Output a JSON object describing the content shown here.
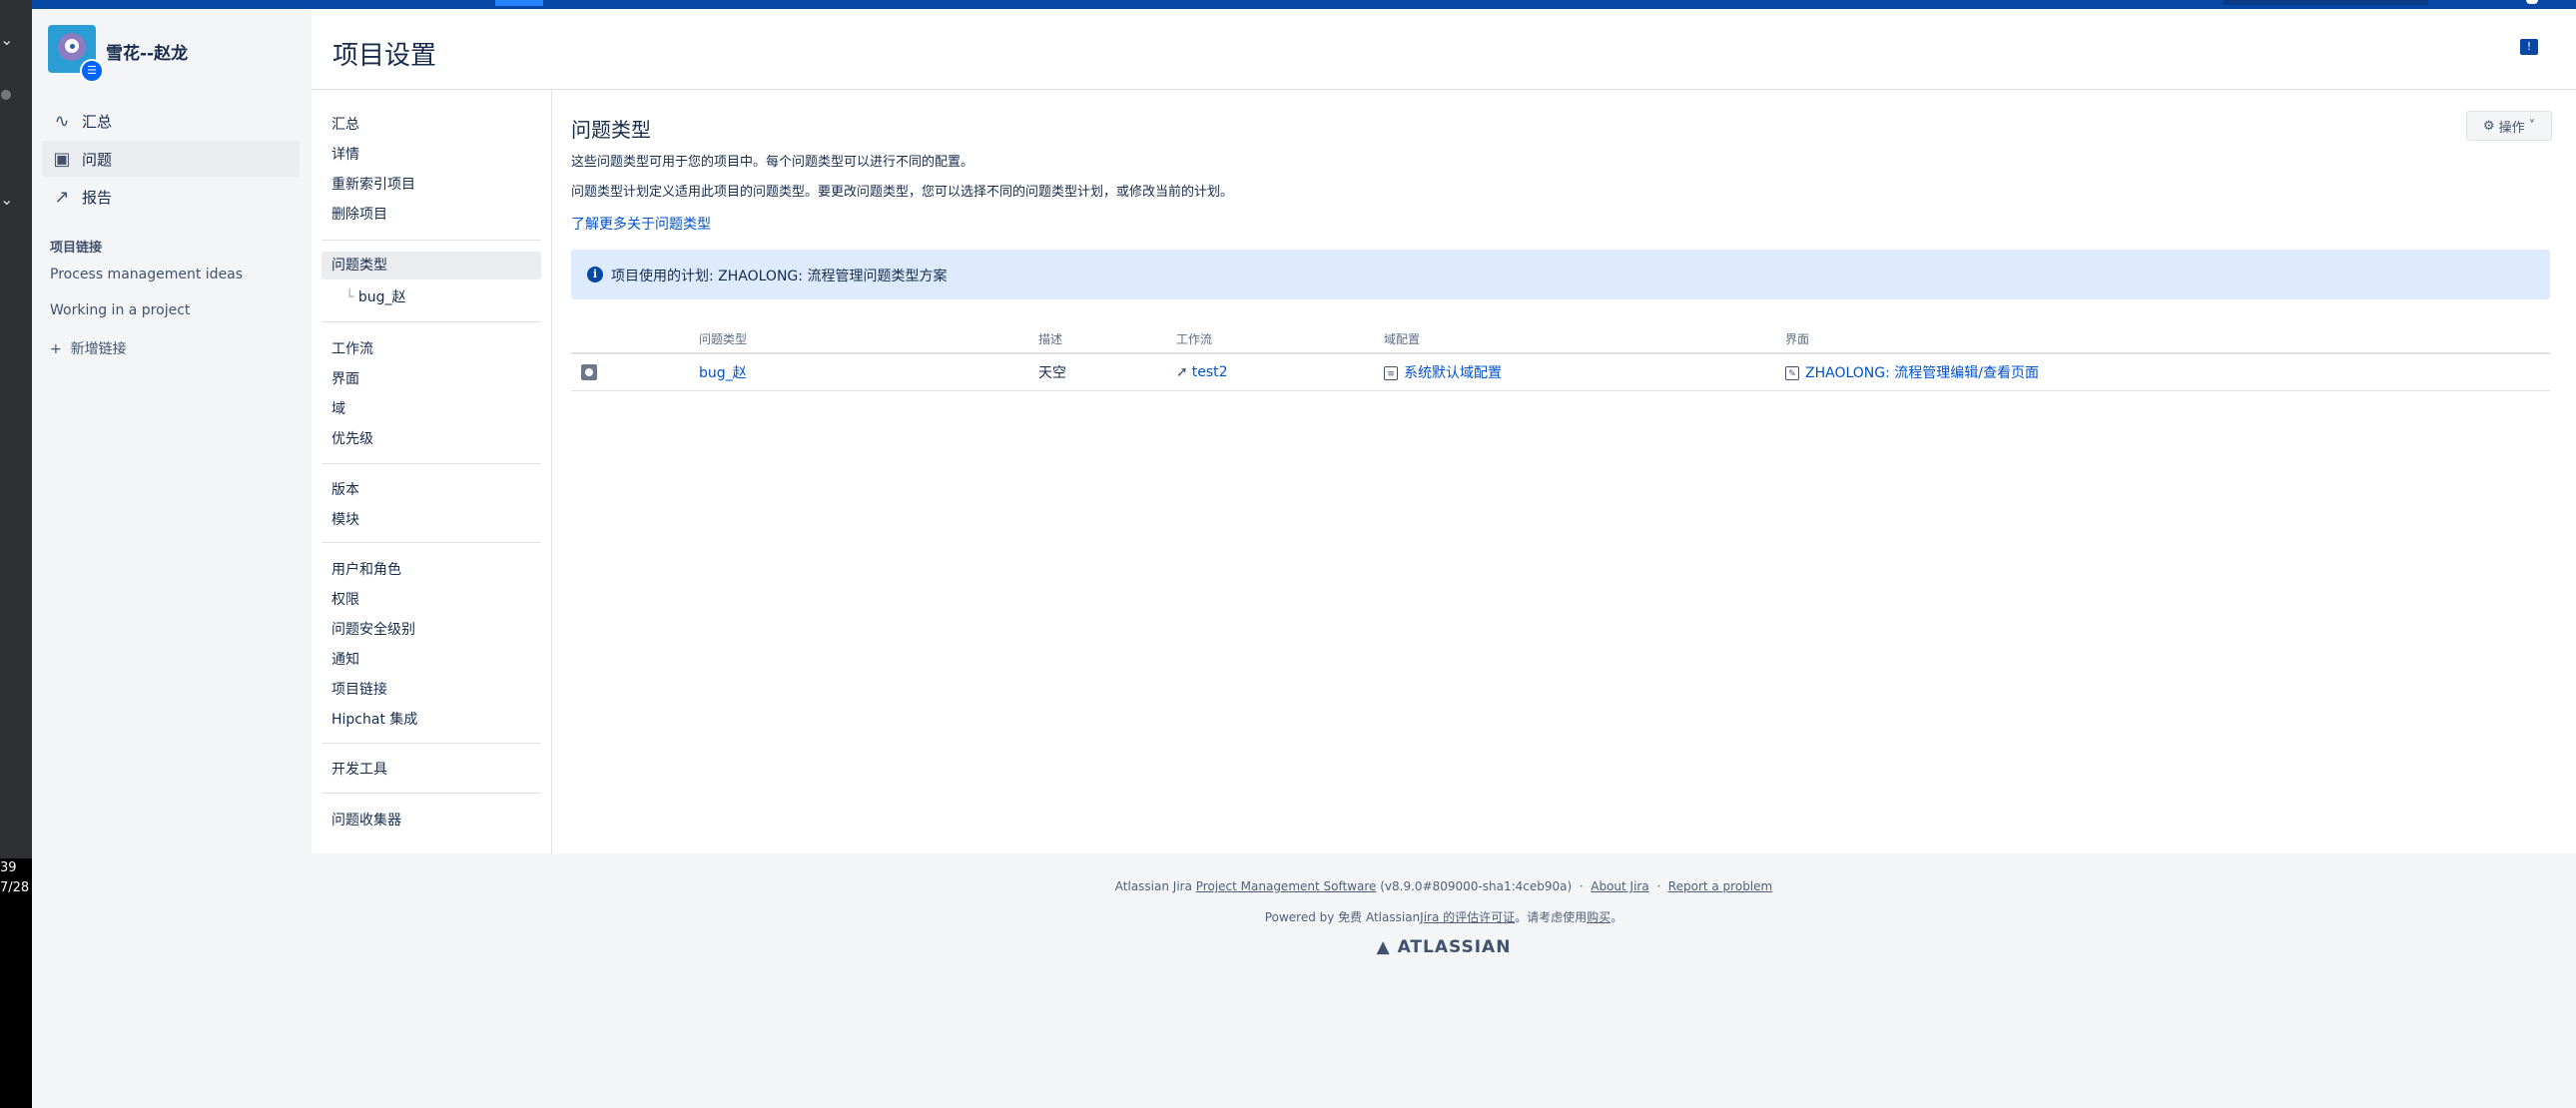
{
  "os": {
    "clock_line1": "39",
    "clock_line2": "7/28"
  },
  "sidebar": {
    "project_name": "雪花--赵龙",
    "items": [
      {
        "label": "汇总",
        "icon": "activity-icon"
      },
      {
        "label": "问题",
        "icon": "issues-icon"
      },
      {
        "label": "报告",
        "icon": "reports-icon"
      }
    ],
    "links_heading": "项目链接",
    "links": [
      "Process management ideas",
      "Working in a project"
    ],
    "add_link_label": "新增链接"
  },
  "header": {
    "title": "项目设置"
  },
  "admin_nav": {
    "summary": "汇总",
    "details": "详情",
    "reindex": "重新索引项目",
    "delete": "删除项目",
    "issue_types": "问题类型",
    "issue_type_sub": "bug_赵",
    "workflows": "工作流",
    "screens": "界面",
    "fields": "域",
    "priorities": "优先级",
    "versions": "版本",
    "components": "模块",
    "users_roles": "用户和角色",
    "permissions": "权限",
    "issue_security": "问题安全级别",
    "notifications": "通知",
    "project_links": "项目链接",
    "hipchat": "Hipchat 集成",
    "dev_tools": "开发工具",
    "issue_collectors": "问题收集器"
  },
  "main": {
    "section_title": "问题类型",
    "actions_label": "操作",
    "desc1": "这些问题类型可用于您的项目中。每个问题类型可以进行不同的配置。",
    "desc2": "问题类型计划定义适用此项目的问题类型。要更改问题类型，您可以选择不同的问题类型计划，或修改当前的计划。",
    "learn_more": "了解更多关于问题类型",
    "info_banner": "项目使用的计划: ZHAOLONG: 流程管理问题类型方案",
    "table": {
      "headers": [
        "问题类型",
        "描述",
        "工作流",
        "域配置",
        "界面"
      ],
      "rows": [
        {
          "issue_type": "bug_赵",
          "description": "天空",
          "workflow": "test2",
          "field_config": "系统默认域配置",
          "screen": "ZHAOLONG: 流程管理编辑/查看页面"
        }
      ]
    }
  },
  "footer": {
    "prefix": "Atlassian Jira",
    "pms_link": "Project Management Software",
    "version": "(v8.9.0#809000-sha1:4ceb90a)",
    "about": "About Jira",
    "report": "Report a problem",
    "powered_prefix": "Powered by 免费 Atlassian",
    "license_link": "Jira 的评估许可证",
    "powered_mid": "。请考虑使用",
    "purchase_link": "购买",
    "powered_end": "。",
    "logo": "ATLASSIAN"
  },
  "colors": {
    "topbar": "#0747a6",
    "link": "#0052cc",
    "banner": "#deebff"
  }
}
